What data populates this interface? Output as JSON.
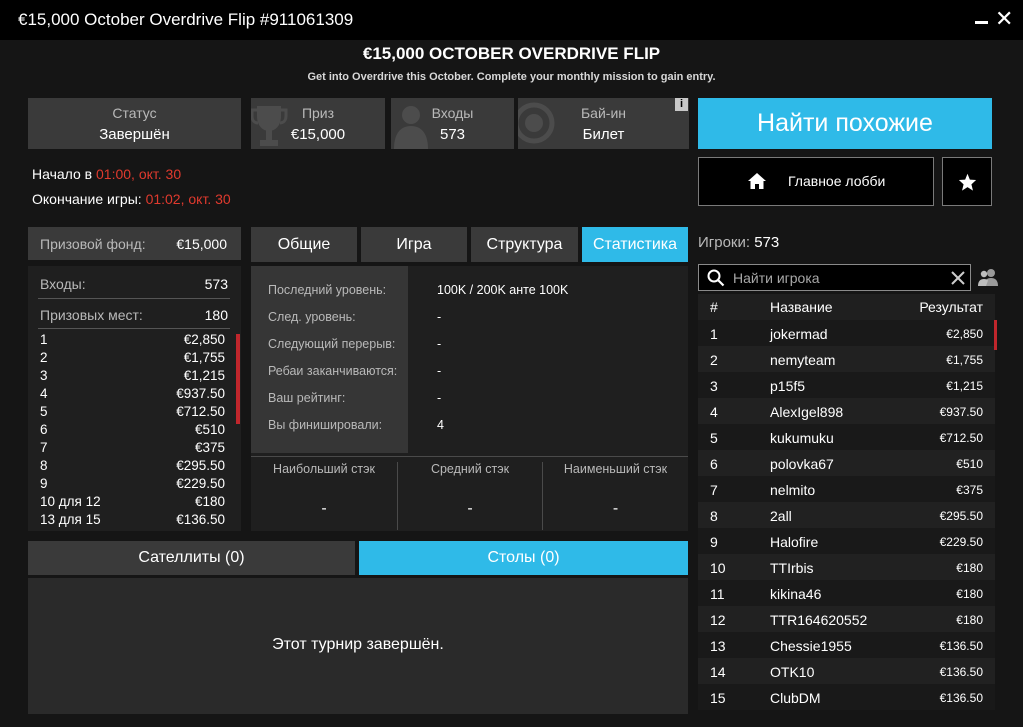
{
  "window": {
    "title": "€15,000 October Overdrive Flip #911061309"
  },
  "header": {
    "title": "€15,000 OCTOBER OVERDRIVE FLIP",
    "subtitle": "Get into Overdrive this October. Complete your monthly mission to gain entry."
  },
  "info": {
    "status": {
      "label": "Статус",
      "value": "Завершён"
    },
    "prize": {
      "label": "Приз",
      "value": "€15,000"
    },
    "entries": {
      "label": "Входы",
      "value": "573"
    },
    "buyin": {
      "label": "Бай-ин",
      "value": "Билет"
    },
    "badge": "i"
  },
  "times": {
    "start_label": "Начало в",
    "start_time": "01:00",
    "start_date": ", окт. 30",
    "end_label": "Окончание игры:",
    "end_time": "01:02",
    "end_date": ", окт. 30"
  },
  "actions": {
    "find_similar": "Найти похожие",
    "main_lobby": "Главное лобби"
  },
  "prize_pool": {
    "label": "Призовой фонд:",
    "value": "€15,000",
    "entries_label": "Входы:",
    "entries_value": "573",
    "places_label": "Призовых мест:",
    "places_value": "180",
    "payouts": [
      {
        "place": "1",
        "amount": "€2,850"
      },
      {
        "place": "2",
        "amount": "€1,755"
      },
      {
        "place": "3",
        "amount": "€1,215"
      },
      {
        "place": "4",
        "amount": "€937.50"
      },
      {
        "place": "5",
        "amount": "€712.50"
      },
      {
        "place": "6",
        "amount": "€510"
      },
      {
        "place": "7",
        "amount": "€375"
      },
      {
        "place": "8",
        "amount": "€295.50"
      },
      {
        "place": "9",
        "amount": "€229.50"
      },
      {
        "place": "10 для 12",
        "amount": "€180"
      },
      {
        "place": "13 для 15",
        "amount": "€136.50"
      }
    ]
  },
  "tabs": [
    {
      "label": "Общие"
    },
    {
      "label": "Игра"
    },
    {
      "label": "Структура"
    },
    {
      "label": "Статистика"
    }
  ],
  "stats": {
    "rows": [
      {
        "label": "Последний уровень:",
        "value": "100K / 200K анте 100K"
      },
      {
        "label": "След. уровень:",
        "value": "-"
      },
      {
        "label": "Следующий перерыв:",
        "value": "-"
      },
      {
        "label": "Ребаи заканчиваются:",
        "value": "-"
      },
      {
        "label": "Ваш рейтинг:",
        "value": "-"
      },
      {
        "label": "Вы финишировали:",
        "value": "4"
      }
    ],
    "stacks": [
      {
        "label": "Наибольший стэк",
        "value": "-"
      },
      {
        "label": "Средний стэк",
        "value": "-"
      },
      {
        "label": "Наименьший стэк",
        "value": "-"
      }
    ]
  },
  "bottom": {
    "satellites_tab": "Сателлиты (0)",
    "tables_tab": "Столы (0)",
    "message": "Этот турнир завершён."
  },
  "players": {
    "label": "Игроки:",
    "count": "573",
    "search_placeholder": "Найти игрока",
    "columns": {
      "num": "#",
      "name": "Название",
      "result": "Результат"
    },
    "rows": [
      {
        "num": "1",
        "name": "jokermad",
        "result": "€2,850"
      },
      {
        "num": "2",
        "name": "nemyteam",
        "result": "€1,755"
      },
      {
        "num": "3",
        "name": "p15f5",
        "result": "€1,215"
      },
      {
        "num": "4",
        "name": "AlexIgel898",
        "result": "€937.50"
      },
      {
        "num": "5",
        "name": "kukumuku",
        "result": "€712.50"
      },
      {
        "num": "6",
        "name": "polovka67",
        "result": "€510"
      },
      {
        "num": "7",
        "name": "nelmito",
        "result": "€375"
      },
      {
        "num": "8",
        "name": "2all",
        "result": "€295.50"
      },
      {
        "num": "9",
        "name": "Halofire",
        "result": "€229.50"
      },
      {
        "num": "10",
        "name": "TTIrbis",
        "result": "€180"
      },
      {
        "num": "11",
        "name": "kikina46",
        "result": "€180"
      },
      {
        "num": "12",
        "name": "TTR164620552",
        "result": "€180"
      },
      {
        "num": "13",
        "name": "Chessie1955",
        "result": "€136.50"
      },
      {
        "num": "14",
        "name": "OTK10",
        "result": "€136.50"
      },
      {
        "num": "15",
        "name": "ClubDM",
        "result": "€136.50"
      }
    ]
  },
  "colors": {
    "accent": "#2fbae8",
    "highlight_red": "#e03a2e",
    "panel": "#3a3a3a"
  }
}
